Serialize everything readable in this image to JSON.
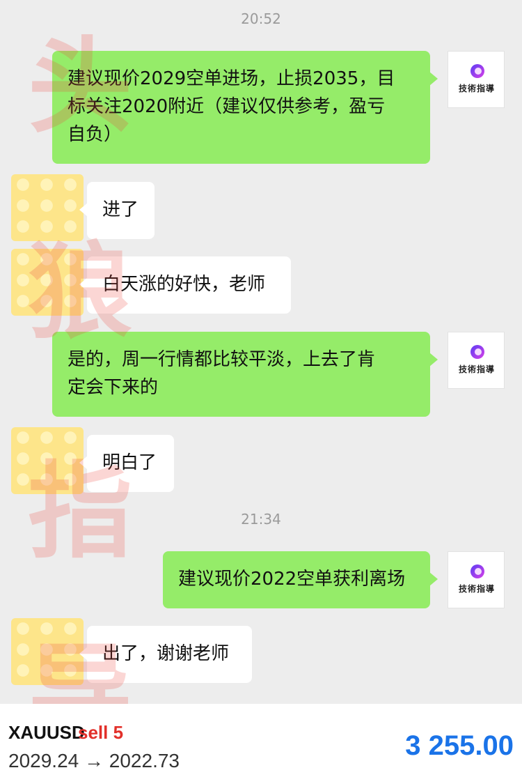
{
  "chat": {
    "timestamps": [
      "20:52",
      "21:34"
    ],
    "messages": [
      {
        "sender": "teacher",
        "text": "建议现价2029空单进场，止损2035，目\n标关注2020附近（建议仅供参考，盈亏\n自负）"
      },
      {
        "sender": "client",
        "text": "进了"
      },
      {
        "sender": "client",
        "text": "白天涨的好快，老师"
      },
      {
        "sender": "teacher",
        "text": "是的，周一行情都比较平淡，上去了肯\n定会下来的"
      },
      {
        "sender": "client",
        "text": "明白了"
      },
      {
        "sender": "teacher",
        "text": "建议现价2022空单获利离场"
      },
      {
        "sender": "client",
        "text": "出了，谢谢老师"
      }
    ],
    "teacher_avatar_text": "技術指導",
    "watermark_chars": [
      "头",
      "狼",
      "指",
      "导"
    ]
  },
  "trade": {
    "symbol": "XAUUSD",
    "side": "sell 5",
    "open_price": "2029.24",
    "arrow": "→",
    "close_price": "2022.73",
    "profit": "3 255.00"
  },
  "colors": {
    "background": "#ededed",
    "outgoing_bubble": "#95ec69",
    "incoming_bubble": "#ffffff",
    "sell_label": "#e2302a",
    "profit": "#1a73e8",
    "watermark": "#eb463c"
  }
}
